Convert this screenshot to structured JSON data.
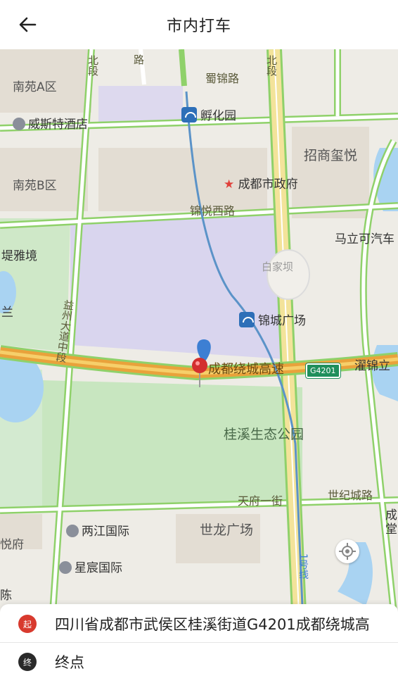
{
  "header": {
    "title": "市内打车"
  },
  "map": {
    "labels": {
      "nanyuanA": "南苑A区",
      "weisite": "威斯特酒店",
      "shuijin": "蜀锦路",
      "fuhuayuan": "孵化园",
      "zhaoshang": "招商玺悦",
      "nanyuanB": "南苑B区",
      "zhengfu": "成都市政府",
      "jinyue": "锦悦西路",
      "malike": "马立可汽车",
      "diyajing": "堤雅境",
      "baijiaba": "白家坝",
      "jincheng": "锦城广场",
      "lan": "兰",
      "yizhou": "益州大道中段",
      "raocheng": "成都绕城高速",
      "hwy_badge": "G4201",
      "guanjin": "濯锦立",
      "guixi": "桂溪生态公园",
      "tianfu": "天府一街",
      "shiji": "世纪城路",
      "liangjiang": "两江国际",
      "shilong": "世龙广场",
      "yuefu": "悦府",
      "xingchen": "星宸国际",
      "chen": "陈",
      "line1": "1号线",
      "cheng": "成",
      "tang": "堂",
      "duan_left": "段",
      "beiduan": "北段",
      "lu": "路"
    }
  },
  "trip": {
    "start_badge": "起",
    "start_address": "四川省成都市武侯区桂溪街道G4201成都绕城高",
    "end_badge": "终",
    "end_placeholder": "终点"
  }
}
